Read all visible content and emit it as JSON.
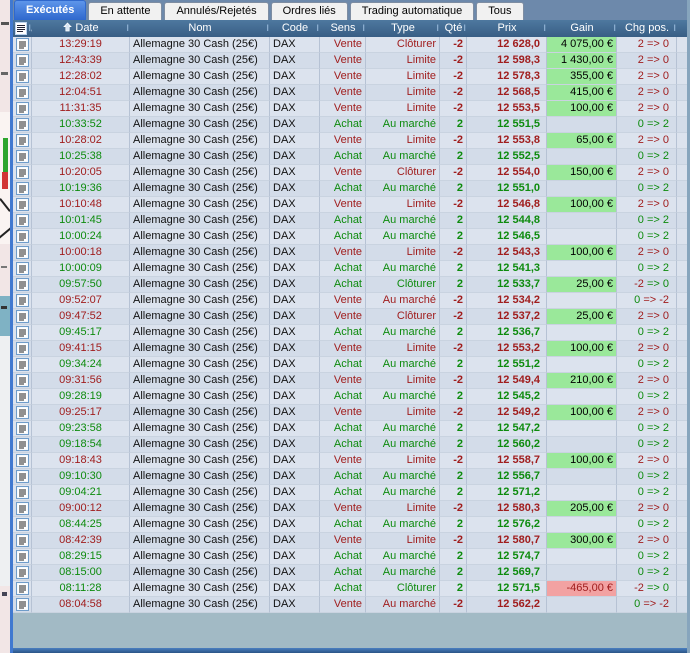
{
  "tabbar": {
    "tabs": [
      {
        "label": "Exécutés",
        "active": true
      },
      {
        "label": "En attente",
        "active": false
      },
      {
        "label": "Annulés/Rejetés",
        "active": false
      },
      {
        "label": "Ordres liés",
        "active": false
      },
      {
        "label": "Trading automatique",
        "active": false
      },
      {
        "label": "Tous",
        "active": false
      }
    ]
  },
  "columns": {
    "date": "Date",
    "nom": "Nom",
    "code": "Code",
    "sens": "Sens",
    "type": "Type",
    "qty": "Qté",
    "prix": "Prix",
    "gain": "Gain",
    "chg": "Chg pos."
  },
  "colors": {
    "active_tab": "#3c7be0",
    "header_bg": "#44688e",
    "buy_text": "#0d8b0d",
    "sell_text": "#a01d1d",
    "gain_positive_bg": "#9ae89a",
    "gain_negative_bg": "#f2a2a2"
  },
  "table": {
    "instrument": "Allemagne 30 Cash (25€)",
    "code": "DAX",
    "chg_arrow": "=>",
    "rows": [
      {
        "time": "13:29:19",
        "sens": "Vente",
        "type": "Clôturer",
        "qty": "-2",
        "prix": "12 628,0",
        "gain": "4 075,00 €",
        "gain_sign": "pos",
        "chg_from": "2",
        "chg_to": "0",
        "chg_from_color": "sell",
        "chg_to_color": "sell"
      },
      {
        "time": "12:43:39",
        "sens": "Vente",
        "type": "Limite",
        "qty": "-2",
        "prix": "12 598,3",
        "gain": "1 430,00 €",
        "gain_sign": "pos",
        "chg_from": "2",
        "chg_to": "0",
        "chg_from_color": "sell",
        "chg_to_color": "sell"
      },
      {
        "time": "12:28:02",
        "sens": "Vente",
        "type": "Limite",
        "qty": "-2",
        "prix": "12 578,3",
        "gain": "355,00 €",
        "gain_sign": "pos",
        "chg_from": "2",
        "chg_to": "0",
        "chg_from_color": "sell",
        "chg_to_color": "sell"
      },
      {
        "time": "12:04:51",
        "sens": "Vente",
        "type": "Limite",
        "qty": "-2",
        "prix": "12 568,5",
        "gain": "415,00 €",
        "gain_sign": "pos",
        "chg_from": "2",
        "chg_to": "0",
        "chg_from_color": "sell",
        "chg_to_color": "sell"
      },
      {
        "time": "11:31:35",
        "sens": "Vente",
        "type": "Limite",
        "qty": "-2",
        "prix": "12 553,5",
        "gain": "100,00 €",
        "gain_sign": "pos",
        "chg_from": "2",
        "chg_to": "0",
        "chg_from_color": "sell",
        "chg_to_color": "sell"
      },
      {
        "time": "10:33:52",
        "sens": "Achat",
        "type": "Au marché",
        "qty": "2",
        "prix": "12 551,5",
        "gain": "",
        "gain_sign": "none",
        "chg_from": "0",
        "chg_to": "2",
        "chg_from_color": "buy",
        "chg_to_color": "buy"
      },
      {
        "time": "10:28:02",
        "sens": "Vente",
        "type": "Limite",
        "qty": "-2",
        "prix": "12 553,8",
        "gain": "65,00 €",
        "gain_sign": "pos",
        "chg_from": "2",
        "chg_to": "0",
        "chg_from_color": "sell",
        "chg_to_color": "sell"
      },
      {
        "time": "10:25:38",
        "sens": "Achat",
        "type": "Au marché",
        "qty": "2",
        "prix": "12 552,5",
        "gain": "",
        "gain_sign": "none",
        "chg_from": "0",
        "chg_to": "2",
        "chg_from_color": "buy",
        "chg_to_color": "buy"
      },
      {
        "time": "10:20:05",
        "sens": "Vente",
        "type": "Clôturer",
        "qty": "-2",
        "prix": "12 554,0",
        "gain": "150,00 €",
        "gain_sign": "pos",
        "chg_from": "2",
        "chg_to": "0",
        "chg_from_color": "sell",
        "chg_to_color": "sell"
      },
      {
        "time": "10:19:36",
        "sens": "Achat",
        "type": "Au marché",
        "qty": "2",
        "prix": "12 551,0",
        "gain": "",
        "gain_sign": "none",
        "chg_from": "0",
        "chg_to": "2",
        "chg_from_color": "buy",
        "chg_to_color": "buy"
      },
      {
        "time": "10:10:48",
        "sens": "Vente",
        "type": "Limite",
        "qty": "-2",
        "prix": "12 546,8",
        "gain": "100,00 €",
        "gain_sign": "pos",
        "chg_from": "2",
        "chg_to": "0",
        "chg_from_color": "sell",
        "chg_to_color": "sell"
      },
      {
        "time": "10:01:45",
        "sens": "Achat",
        "type": "Au marché",
        "qty": "2",
        "prix": "12 544,8",
        "gain": "",
        "gain_sign": "none",
        "chg_from": "0",
        "chg_to": "2",
        "chg_from_color": "buy",
        "chg_to_color": "buy"
      },
      {
        "time": "10:00:24",
        "sens": "Achat",
        "type": "Au marché",
        "qty": "2",
        "prix": "12 546,5",
        "gain": "",
        "gain_sign": "none",
        "chg_from": "0",
        "chg_to": "2",
        "chg_from_color": "buy",
        "chg_to_color": "buy"
      },
      {
        "time": "10:00:18",
        "sens": "Vente",
        "type": "Limite",
        "qty": "-2",
        "prix": "12 543,3",
        "gain": "100,00 €",
        "gain_sign": "pos",
        "chg_from": "2",
        "chg_to": "0",
        "chg_from_color": "sell",
        "chg_to_color": "sell"
      },
      {
        "time": "10:00:09",
        "sens": "Achat",
        "type": "Au marché",
        "qty": "2",
        "prix": "12 541,3",
        "gain": "",
        "gain_sign": "none",
        "chg_from": "0",
        "chg_to": "2",
        "chg_from_color": "buy",
        "chg_to_color": "buy"
      },
      {
        "time": "09:57:50",
        "sens": "Achat",
        "type": "Clôturer",
        "qty": "2",
        "prix": "12 533,7",
        "gain": "25,00 €",
        "gain_sign": "pos",
        "chg_from": "-2",
        "chg_to": "0",
        "chg_from_color": "sell",
        "chg_to_color": "buy"
      },
      {
        "time": "09:52:07",
        "sens": "Vente",
        "type": "Au marché",
        "qty": "-2",
        "prix": "12 534,2",
        "gain": "",
        "gain_sign": "none",
        "chg_from": "0",
        "chg_to": "-2",
        "chg_from_color": "buy",
        "chg_to_color": "sell"
      },
      {
        "time": "09:47:52",
        "sens": "Vente",
        "type": "Clôturer",
        "qty": "-2",
        "prix": "12 537,2",
        "gain": "25,00 €",
        "gain_sign": "pos",
        "chg_from": "2",
        "chg_to": "0",
        "chg_from_color": "sell",
        "chg_to_color": "sell"
      },
      {
        "time": "09:45:17",
        "sens": "Achat",
        "type": "Au marché",
        "qty": "2",
        "prix": "12 536,7",
        "gain": "",
        "gain_sign": "none",
        "chg_from": "0",
        "chg_to": "2",
        "chg_from_color": "buy",
        "chg_to_color": "buy"
      },
      {
        "time": "09:41:15",
        "sens": "Vente",
        "type": "Limite",
        "qty": "-2",
        "prix": "12 553,2",
        "gain": "100,00 €",
        "gain_sign": "pos",
        "chg_from": "2",
        "chg_to": "0",
        "chg_from_color": "sell",
        "chg_to_color": "sell"
      },
      {
        "time": "09:34:24",
        "sens": "Achat",
        "type": "Au marché",
        "qty": "2",
        "prix": "12 551,2",
        "gain": "",
        "gain_sign": "none",
        "chg_from": "0",
        "chg_to": "2",
        "chg_from_color": "buy",
        "chg_to_color": "buy"
      },
      {
        "time": "09:31:56",
        "sens": "Vente",
        "type": "Limite",
        "qty": "-2",
        "prix": "12 549,4",
        "gain": "210,00 €",
        "gain_sign": "pos",
        "chg_from": "2",
        "chg_to": "0",
        "chg_from_color": "sell",
        "chg_to_color": "sell"
      },
      {
        "time": "09:28:19",
        "sens": "Achat",
        "type": "Au marché",
        "qty": "2",
        "prix": "12 545,2",
        "gain": "",
        "gain_sign": "none",
        "chg_from": "0",
        "chg_to": "2",
        "chg_from_color": "buy",
        "chg_to_color": "buy"
      },
      {
        "time": "09:25:17",
        "sens": "Vente",
        "type": "Limite",
        "qty": "-2",
        "prix": "12 549,2",
        "gain": "100,00 €",
        "gain_sign": "pos",
        "chg_from": "2",
        "chg_to": "0",
        "chg_from_color": "sell",
        "chg_to_color": "sell"
      },
      {
        "time": "09:23:58",
        "sens": "Achat",
        "type": "Au marché",
        "qty": "2",
        "prix": "12 547,2",
        "gain": "",
        "gain_sign": "none",
        "chg_from": "0",
        "chg_to": "2",
        "chg_from_color": "buy",
        "chg_to_color": "buy"
      },
      {
        "time": "09:18:54",
        "sens": "Achat",
        "type": "Au marché",
        "qty": "2",
        "prix": "12 560,2",
        "gain": "",
        "gain_sign": "none",
        "chg_from": "0",
        "chg_to": "2",
        "chg_from_color": "buy",
        "chg_to_color": "buy"
      },
      {
        "time": "09:18:43",
        "sens": "Vente",
        "type": "Limite",
        "qty": "-2",
        "prix": "12 558,7",
        "gain": "100,00 €",
        "gain_sign": "pos",
        "chg_from": "2",
        "chg_to": "0",
        "chg_from_color": "sell",
        "chg_to_color": "sell"
      },
      {
        "time": "09:10:30",
        "sens": "Achat",
        "type": "Au marché",
        "qty": "2",
        "prix": "12 556,7",
        "gain": "",
        "gain_sign": "none",
        "chg_from": "0",
        "chg_to": "2",
        "chg_from_color": "buy",
        "chg_to_color": "buy"
      },
      {
        "time": "09:04:21",
        "sens": "Achat",
        "type": "Au marché",
        "qty": "2",
        "prix": "12 571,2",
        "gain": "",
        "gain_sign": "none",
        "chg_from": "0",
        "chg_to": "2",
        "chg_from_color": "buy",
        "chg_to_color": "buy"
      },
      {
        "time": "09:00:12",
        "sens": "Vente",
        "type": "Limite",
        "qty": "-2",
        "prix": "12 580,3",
        "gain": "205,00 €",
        "gain_sign": "pos",
        "chg_from": "2",
        "chg_to": "0",
        "chg_from_color": "sell",
        "chg_to_color": "sell"
      },
      {
        "time": "08:44:25",
        "sens": "Achat",
        "type": "Au marché",
        "qty": "2",
        "prix": "12 576,2",
        "gain": "",
        "gain_sign": "none",
        "chg_from": "0",
        "chg_to": "2",
        "chg_from_color": "buy",
        "chg_to_color": "buy"
      },
      {
        "time": "08:42:39",
        "sens": "Vente",
        "type": "Limite",
        "qty": "-2",
        "prix": "12 580,7",
        "gain": "300,00 €",
        "gain_sign": "pos",
        "chg_from": "2",
        "chg_to": "0",
        "chg_from_color": "sell",
        "chg_to_color": "sell"
      },
      {
        "time": "08:29:15",
        "sens": "Achat",
        "type": "Au marché",
        "qty": "2",
        "prix": "12 574,7",
        "gain": "",
        "gain_sign": "none",
        "chg_from": "0",
        "chg_to": "2",
        "chg_from_color": "buy",
        "chg_to_color": "buy"
      },
      {
        "time": "08:15:00",
        "sens": "Achat",
        "type": "Au marché",
        "qty": "2",
        "prix": "12 569,7",
        "gain": "",
        "gain_sign": "none",
        "chg_from": "0",
        "chg_to": "2",
        "chg_from_color": "buy",
        "chg_to_color": "buy"
      },
      {
        "time": "08:11:28",
        "sens": "Achat",
        "type": "Clôturer",
        "qty": "2",
        "prix": "12 571,5",
        "gain": "-465,00 €",
        "gain_sign": "neg",
        "chg_from": "-2",
        "chg_to": "0",
        "chg_from_color": "sell",
        "chg_to_color": "buy"
      },
      {
        "time": "08:04:58",
        "sens": "Vente",
        "type": "Au marché",
        "qty": "-2",
        "prix": "12 562,2",
        "gain": "",
        "gain_sign": "none",
        "chg_from": "0",
        "chg_to": "-2",
        "chg_from_color": "buy",
        "chg_to_color": "sell"
      }
    ]
  }
}
